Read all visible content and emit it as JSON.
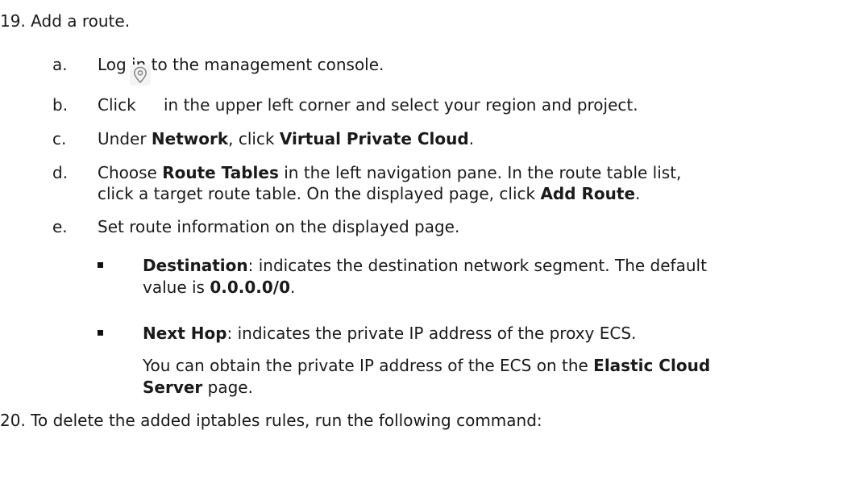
{
  "step19": {
    "number": "19.",
    "title": "Add a route.",
    "substeps": [
      {
        "letter": "a.",
        "text": "Log in to the management console."
      },
      {
        "letter": "b.",
        "prefix": "Click",
        "icon": "location-pin-icon",
        "suffix": "in the upper left corner and select your region and project."
      },
      {
        "letter": "c.",
        "t1": "Under ",
        "b1": "Network",
        "t2": ", click ",
        "b2": "Virtual Private Cloud",
        "t3": "."
      },
      {
        "letter": "d.",
        "t1": "Choose ",
        "b1": "Route Tables",
        "t2": " in the left navigation pane. In the route table list,",
        "line2_t1": "click a target route table. On the displayed page, click ",
        "line2_b1": "Add Route",
        "line2_t2": "."
      },
      {
        "letter": "e.",
        "text": "Set route information on the displayed page.",
        "bullets": [
          {
            "label": "Destination",
            "text": ": indicates the destination network segment. The default",
            "line2_t1": "value is ",
            "line2_b1": "0.0.0.0/0",
            "line2_t2": "."
          },
          {
            "label": "Next Hop",
            "text": ": indicates the private IP address of the proxy ECS.",
            "para_t1": "You can obtain the private IP address of the ECS on the ",
            "para_b1": "Elastic Cloud",
            "para_b2": "Server",
            "para_t2": " page."
          }
        ]
      }
    ]
  },
  "step20": {
    "number": "20.",
    "text": "To delete the added iptables rules, run the following command:"
  },
  "colors": {
    "text": "#1a1a1a",
    "icon_bg": "#f4f4f4",
    "icon_stroke": "#8a8a8a"
  }
}
